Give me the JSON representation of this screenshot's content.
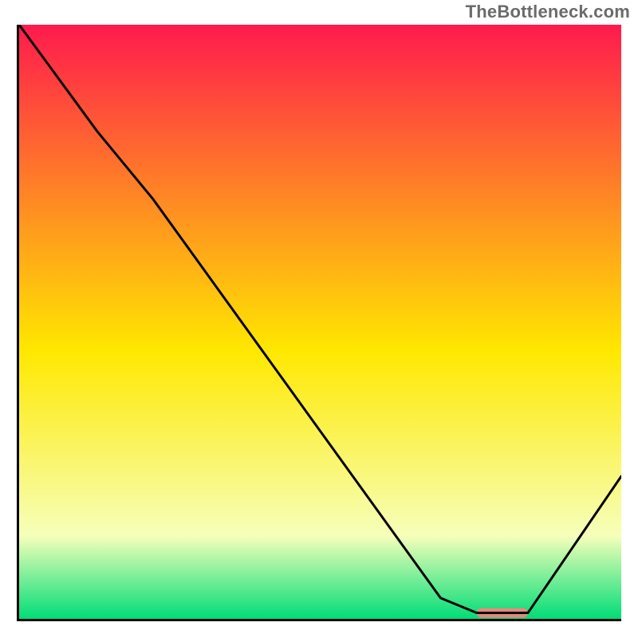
{
  "watermark": "TheBottleneck.com",
  "chart_data": {
    "type": "line",
    "title": "",
    "xlabel": "",
    "ylabel": "",
    "xlim": [
      0,
      100
    ],
    "ylim": [
      0,
      100
    ],
    "grid": false,
    "legend": false,
    "background_gradient": {
      "top_color": "#ff1a4d",
      "yellow_color": "#ffe800",
      "pale_color": "#f6ffba",
      "green_color": "#00dd77",
      "stops_pct": [
        0,
        55,
        86,
        100
      ]
    },
    "series": [
      {
        "name": "bottleneck-curve",
        "color": "#000000",
        "stroke_width": 3,
        "x": [
          0.0,
          13.0,
          22.2,
          70.0,
          76.0,
          84.5,
          100.0
        ],
        "y": [
          100.0,
          82.0,
          70.7,
          3.5,
          1.0,
          1.0,
          24.0
        ],
        "notes": "y≈0 is the optimal (green) zone; peaks at left edge ≈100 (max bottleneck)."
      },
      {
        "name": "optimal-marker",
        "type": "bar",
        "color": "#e8877f",
        "x_range": [
          76.0,
          84.5
        ],
        "y": 1.0,
        "height": 1.6
      }
    ]
  }
}
